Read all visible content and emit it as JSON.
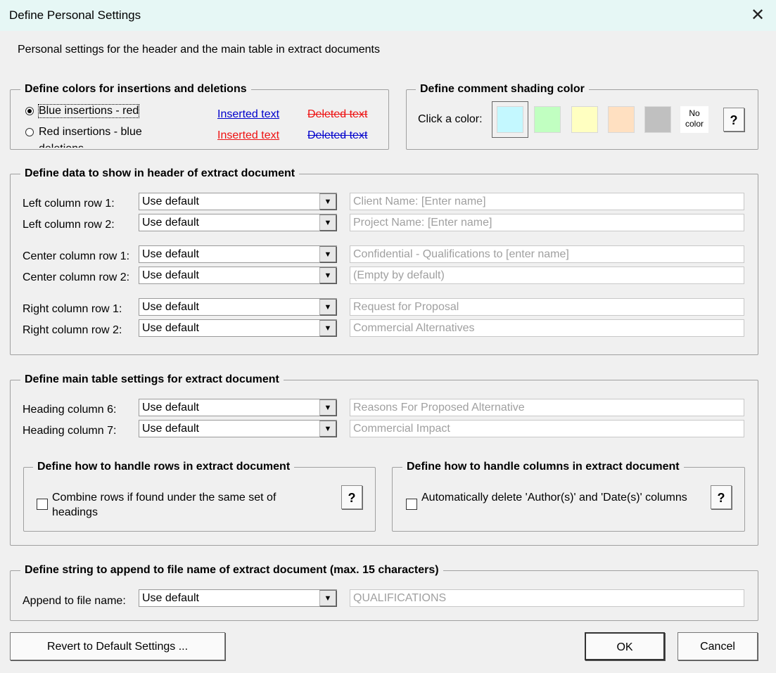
{
  "window": {
    "title": "Define Personal Settings",
    "close_glyph": "✕"
  },
  "intro": "Personal settings for the header and the main table in extract documents",
  "colors": {
    "legend": "Define colors for insertions and deletions",
    "options": [
      {
        "label": "Blue insertions - red",
        "selected": true,
        "inserted_text": "Inserted text",
        "deleted_text": "Deleted text",
        "inserted_color": "#0000cc",
        "deleted_color": "#ee1111"
      },
      {
        "label": "Red insertions - blue",
        "selected": false,
        "inserted_text": "Inserted text",
        "deleted_text": "Deleted text",
        "inserted_color": "#ee1111",
        "deleted_color": "#0000cc"
      }
    ]
  },
  "shading": {
    "legend": "Define comment shading color",
    "click_label": "Click a color:",
    "swatches": [
      "#c4f8ff",
      "#c1ffc1",
      "#ffffc1",
      "#ffe0c1",
      "#c0c0c0"
    ],
    "no_color_label": "No color",
    "help": "?"
  },
  "header_section": {
    "legend": "Define data to show in header of extract document",
    "rows": [
      {
        "label": "Left column row 1:",
        "select": "Use default",
        "text": "Client Name: [Enter name]"
      },
      {
        "label": "Left column row 2:",
        "select": "Use default",
        "text": "Project Name: [Enter name]"
      },
      {
        "label": "Center column row 1:",
        "select": "Use default",
        "text": "Confidential - Qualifications to [enter name]"
      },
      {
        "label": "Center column row 2:",
        "select": "Use default",
        "text": "(Empty by default)"
      },
      {
        "label": "Right column row 1:",
        "select": "Use default",
        "text": "Request for Proposal"
      },
      {
        "label": "Right column row 2:",
        "select": "Use default",
        "text": "Commercial Alternatives"
      }
    ]
  },
  "main_table": {
    "legend": "Define main table settings for extract document",
    "rows": [
      {
        "label": "Heading column 6:",
        "select": "Use default",
        "text": "Reasons For Proposed Alternative"
      },
      {
        "label": "Heading column 7:",
        "select": "Use default",
        "text": "Commercial Impact"
      }
    ],
    "rows_box": {
      "legend": "Define how to handle rows in extract document",
      "checkbox": "Combine rows if found under the same set of headings",
      "checked": false,
      "help": "?"
    },
    "cols_box": {
      "legend": "Define how to handle columns in extract document",
      "checkbox": "Automatically delete 'Author(s)' and 'Date(s)' columns",
      "checked": false,
      "help": "?"
    }
  },
  "append": {
    "legend": "Define string to append to file name of extract document  (max. 15 characters)",
    "label": "Append to file name:",
    "select": "Use default",
    "text": "QUALIFICATIONS"
  },
  "buttons": {
    "revert": "Revert to Default Settings ...",
    "ok": "OK",
    "cancel": "Cancel"
  }
}
